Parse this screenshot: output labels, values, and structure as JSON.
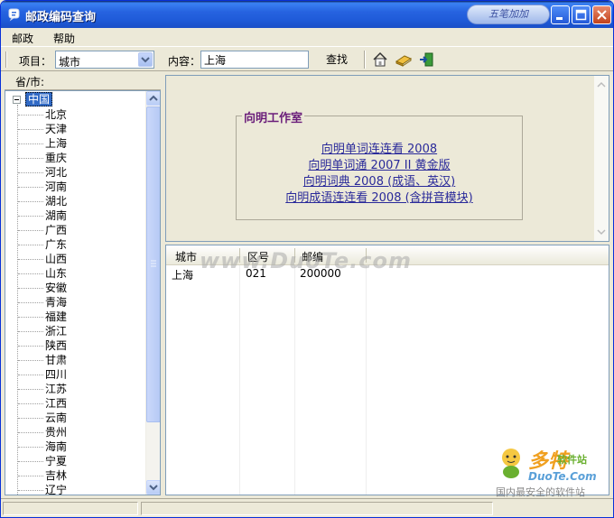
{
  "window": {
    "title": "邮政编码查询",
    "brand": "五笔加加"
  },
  "menu": [
    "邮政",
    "帮助"
  ],
  "toolbar": {
    "item_label": "项目：",
    "item_value": "城市",
    "content_label": "内容：",
    "content_value": "上海",
    "find_label": "查找"
  },
  "tree": {
    "header": "省/市:",
    "root": "中国",
    "items": [
      "北京",
      "天津",
      "上海",
      "重庆",
      "河北",
      "河南",
      "湖北",
      "湖南",
      "广西",
      "广东",
      "山西",
      "山东",
      "安徽",
      "青海",
      "福建",
      "浙江",
      "陕西",
      "甘肃",
      "四川",
      "江苏",
      "江西",
      "云南",
      "贵州",
      "海南",
      "宁夏",
      "吉林",
      "辽宁"
    ]
  },
  "group": {
    "title": "向明工作室",
    "links": [
      "向明单词连连看 2008",
      "向明单词通 2007 II 黄金版",
      "向明词典 2008 (成语、英汉)",
      "向明成语连连看 2008 (含拼音模块)"
    ]
  },
  "list": {
    "columns": [
      "城市",
      "区号",
      "邮编"
    ],
    "rows": [
      [
        "上海",
        "021",
        "200000"
      ]
    ]
  },
  "watermark": "www.DuoTe.com",
  "logo": {
    "main": "多特",
    "sub": "软件站",
    "url": "DuoTe.Com",
    "tag": "国内最安全的软件站"
  }
}
